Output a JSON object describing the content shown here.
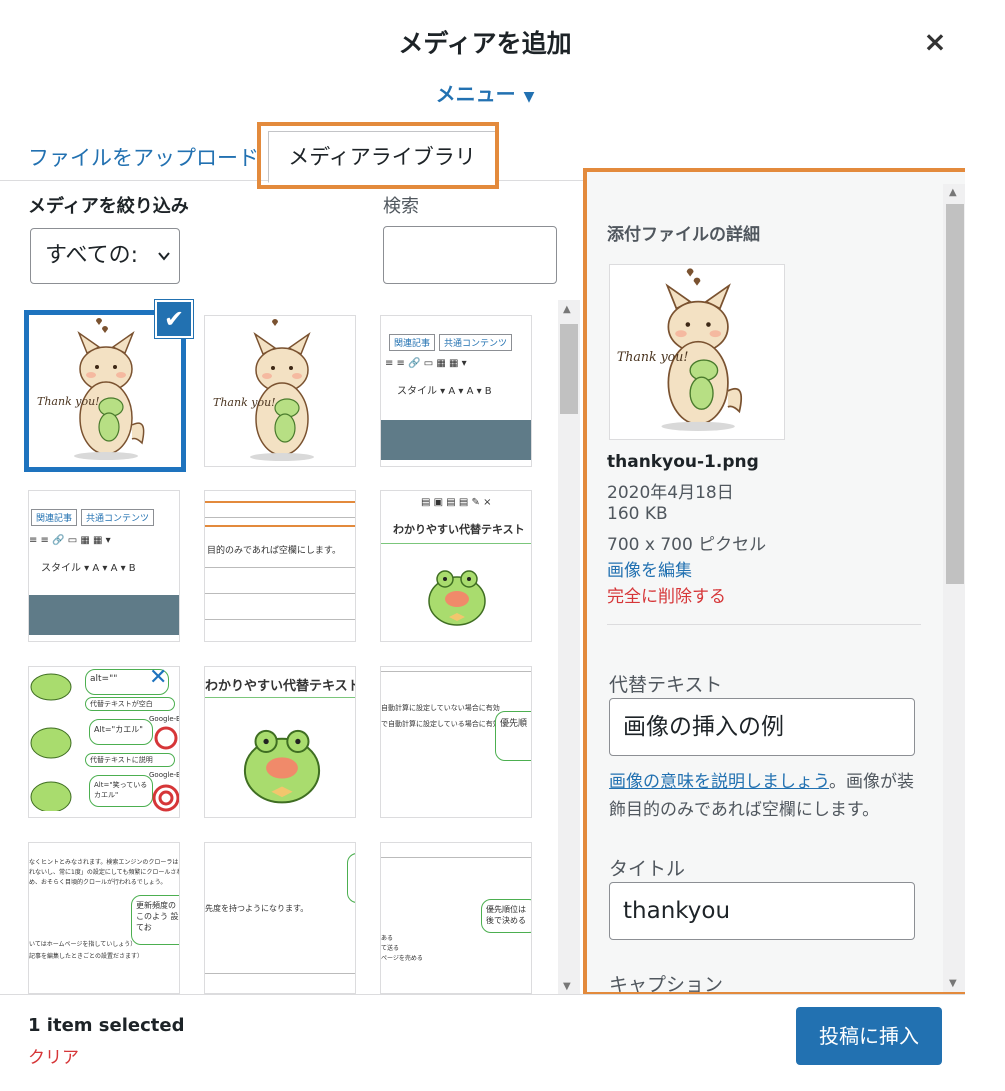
{
  "modal": {
    "title": "メディアを追加",
    "close_symbol": "×",
    "menu_label": "メニュー",
    "menu_arrow": "▼"
  },
  "tabs": [
    {
      "label": "ファイルをアップロード",
      "active": false
    },
    {
      "label": "メディアライブラリ",
      "active": true
    }
  ],
  "filters": {
    "label": "メディアを絞り込み",
    "select_value": "すべての:",
    "search_label": "検索",
    "search_value": ""
  },
  "thumbnails": {
    "thank_you_text": "Thank you!",
    "toolbar_buttons": [
      "関連記事",
      "共通コンテンツ"
    ],
    "toolbar_style": "スタイル ▾  A ▾  A ▾  B",
    "desc_line": "目的のみであれば空欄にします。",
    "alt_title": "わかりやすい代替テキスト",
    "alt_rows": [
      "alt=\"\"",
      "代替テキストが空白",
      "Alt=\"カエル\"",
      "代替テキストに説明",
      "Alt=\"笑っている カエル\""
    ],
    "google_bet": "Google-Bet",
    "priority_text_1": "優先順",
    "auto_text_1": "自動計算に設定していない場合に有効",
    "auto_text_2": "で自動計算に設定している場合に有効",
    "update_freq": "更新頻度の",
    "update_freq_2": "このよう 設定してお",
    "priority_mode": "先度を持つようになります。",
    "priority_text_2": "優先順位は 後で決める"
  },
  "details": {
    "title": "添付ファイルの詳細",
    "filename": "thankyou-1.png",
    "date": "2020年4月18日",
    "size": "160 KB",
    "dimensions": "700 x 700 ピクセル",
    "edit_link": "画像を編集",
    "delete_link": "完全に削除する",
    "alt_label": "代替テキスト",
    "alt_value": "画像の挿入の例",
    "help_link": "画像の意味を説明しましょう",
    "help_text": "。画像が装飾目的のみであれば空欄にします。",
    "title_label": "タイトル",
    "title_value": "thankyou",
    "caption_label": "キャプション"
  },
  "toolbar": {
    "selected_count": "1 item selected",
    "clear_label": "クリア",
    "insert_label": "投稿に挿入"
  },
  "colors": {
    "accent": "#2271b1",
    "highlight": "#e38a3c",
    "danger": "#d63638",
    "selected_border": "#1e73be"
  }
}
